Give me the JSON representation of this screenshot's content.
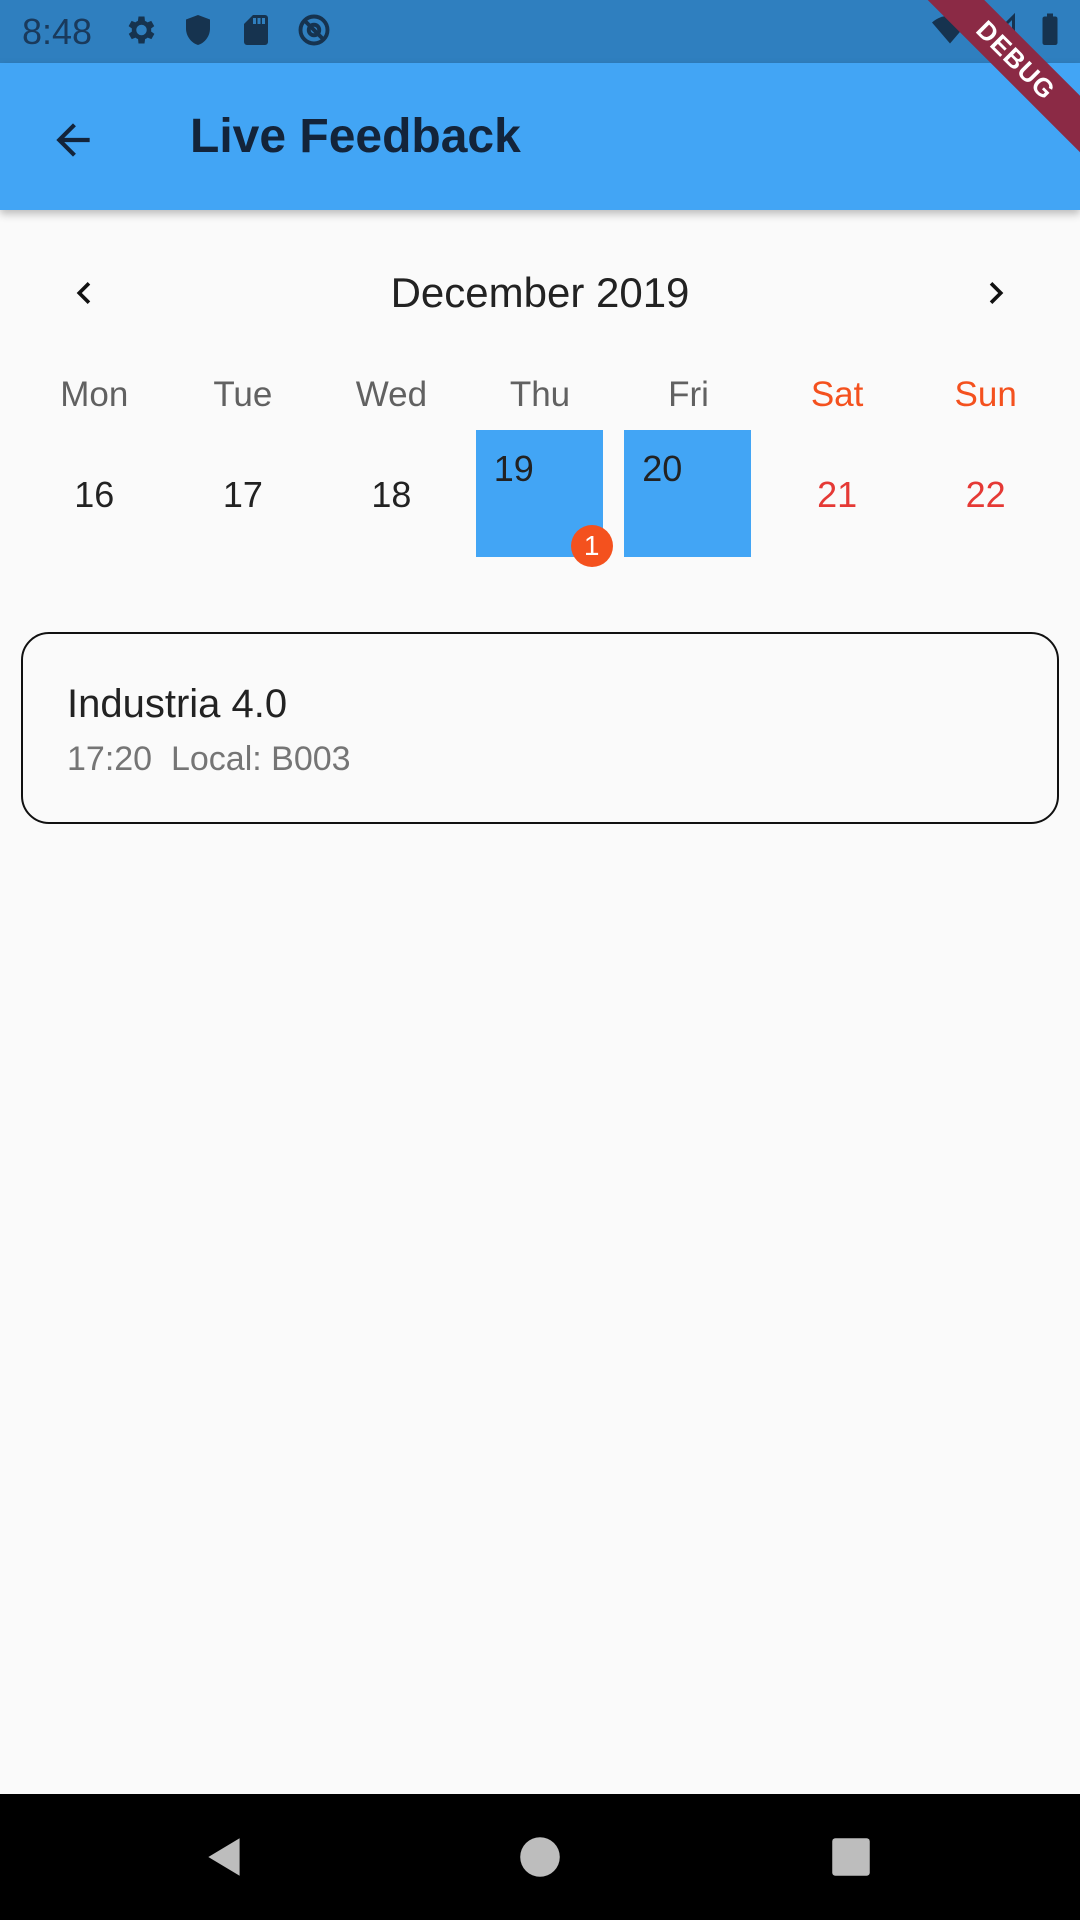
{
  "status_bar": {
    "time": "8:48",
    "left_icons": [
      "settings-icon",
      "shield-icon",
      "sd-card-icon",
      "at-sign-icon"
    ],
    "right_icons": [
      "wifi-icon",
      "cell-signal-icon",
      "battery-icon"
    ]
  },
  "debug_banner": {
    "label": "DEBUG"
  },
  "app_bar": {
    "title": "Live Feedback",
    "back_icon": "arrow-left-icon"
  },
  "calendar": {
    "month_label": "December 2019",
    "weekdays": [
      "Mon",
      "Tue",
      "Wed",
      "Thu",
      "Fri",
      "Sat",
      "Sun"
    ],
    "days": [
      {
        "label": "16"
      },
      {
        "label": "17"
      },
      {
        "label": "18"
      },
      {
        "label": "19",
        "selected": true,
        "badge": "1"
      },
      {
        "label": "20",
        "selected": true
      },
      {
        "label": "21"
      },
      {
        "label": "22"
      }
    ],
    "colors": {
      "selected": "#42a5f5",
      "weekend": "#f4511e",
      "badge": "#f4511e"
    }
  },
  "events": [
    {
      "title": "Industria 4.0",
      "subtitle": "17:20  Local: B003"
    }
  ],
  "colors": {
    "app_bar": "#42a5f5",
    "status_bar": "#2f7fbf"
  }
}
